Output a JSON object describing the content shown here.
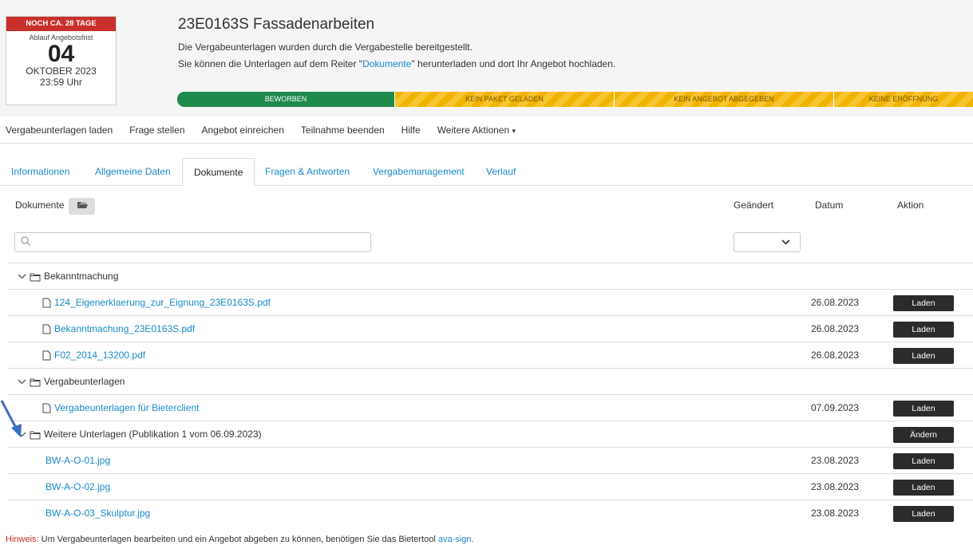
{
  "deadline": {
    "badge": "NOCH CA. 28 TAGE",
    "label": "Ablauf Angebotsfrist",
    "day": "04",
    "month": "OKTOBER 2023",
    "time": "23:59 Uhr"
  },
  "header": {
    "title": "23E0163S Fassadenarbeiten",
    "info_line1": "Die Vergabeunterlagen wurden durch die Vergabestelle bereitgestellt.",
    "info_line2_pre": "Sie können die Unterlagen auf dem Reiter \"",
    "info_line2_link": "Dokumente",
    "info_line2_post": "\" herunterladen und dort Ihr Angebot hochladen."
  },
  "status": {
    "steps": [
      "BEWORBEN",
      "KEIN PAKET GELADEN",
      "KEIN ANGEBOT ABGEGEBEN",
      "KEINE ERÖFFNUNG"
    ],
    "colors": {
      "done": "#1e8a4c",
      "pending": "#f0b400"
    }
  },
  "actions": [
    "Vergabeunterlagen laden",
    "Frage stellen",
    "Angebot einreichen",
    "Teilnahme beenden",
    "Hilfe",
    "Weitere Aktionen"
  ],
  "tabs": [
    "Informationen",
    "Allgemeine Daten",
    "Dokumente",
    "Fragen & Antworten",
    "Vergabemanagement",
    "Verlauf"
  ],
  "table": {
    "col_documents": "Dokumente",
    "col_changed": "Geändert",
    "col_date": "Datum",
    "col_action": "Aktion"
  },
  "rows": [
    {
      "type": "folder",
      "name": "Bekanntmachung"
    },
    {
      "type": "file",
      "name": "124_Eigenerklaerung_zur_Eignung_23E0163S.pdf",
      "date": "26.08.2023",
      "action": "Laden"
    },
    {
      "type": "file",
      "name": "Bekanntmachung_23E0163S.pdf",
      "date": "26.08.2023",
      "action": "Laden"
    },
    {
      "type": "file",
      "name": "F02_2014_13200.pdf",
      "date": "26.08.2023",
      "action": "Laden"
    },
    {
      "type": "folder",
      "name": "Vergabeunterlagen"
    },
    {
      "type": "file",
      "name": "Vergabeunterlagen für Bieterclient",
      "date": "07.09.2023",
      "action": "Laden"
    },
    {
      "type": "folder",
      "name": "Weitere Unterlagen (Publikation 1 vom 06.09.2023)",
      "action": "Ändern"
    },
    {
      "type": "plain",
      "name": "BW-A-O-01.jpg",
      "date": "23.08.2023",
      "action": "Laden"
    },
    {
      "type": "plain",
      "name": "BW-A-O-02.jpg",
      "date": "23.08.2023",
      "action": "Laden"
    },
    {
      "type": "plain",
      "name": "BW-A-O-03_Skulptur.jpg",
      "date": "23.08.2023",
      "action": "Laden"
    }
  ],
  "hint": {
    "label": "Hinweis:",
    "text": " Um Vergabeunterlagen bearbeiten und ein Angebot abgeben zu können, benötigen Sie das Bietertool ",
    "link": "ava-sign",
    "end": "."
  }
}
